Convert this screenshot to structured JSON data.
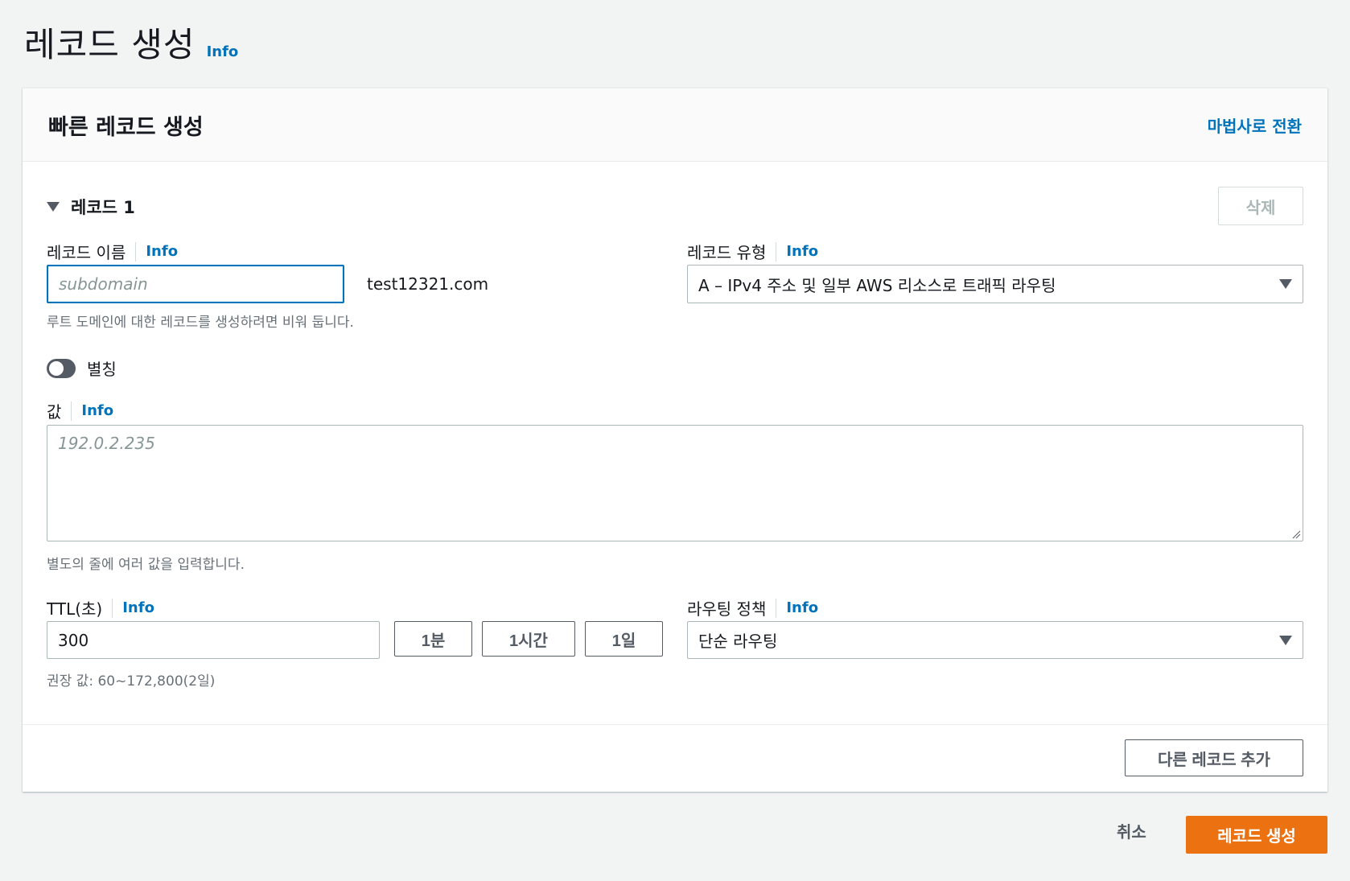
{
  "page": {
    "title": "레코드 생성",
    "info_label": "Info"
  },
  "panel": {
    "title": "빠른 레코드 생성",
    "wizard_link": "마법사로 전환"
  },
  "record": {
    "heading": "레코드 1",
    "delete_label": "삭제",
    "name": {
      "label": "레코드 이름",
      "info": "Info",
      "placeholder": "subdomain",
      "suffix": "test12321.com",
      "hint": "루트 도메인에 대한 레코드를 생성하려면 비워 둡니다."
    },
    "type": {
      "label": "레코드 유형",
      "info": "Info",
      "selected": "A – IPv4 주소 및 일부 AWS 리소스로 트래픽 라우팅"
    },
    "alias": {
      "label": "별칭",
      "enabled": false
    },
    "value": {
      "label": "값",
      "info": "Info",
      "placeholder": "192.0.2.235",
      "hint": "별도의 줄에 여러 값을 입력합니다."
    },
    "ttl": {
      "label": "TTL(초)",
      "info": "Info",
      "value": "300",
      "presets": [
        "1분",
        "1시간",
        "1일"
      ],
      "hint": "권장 값: 60~172,800(2일)"
    },
    "routing": {
      "label": "라우팅 정책",
      "info": "Info",
      "selected": "단순 라우팅"
    }
  },
  "footer": {
    "add_record": "다른 레코드 추가",
    "cancel": "취소",
    "create": "레코드 생성"
  },
  "colors": {
    "primary": "#ec7211",
    "link": "#0073bb",
    "focus_border": "#0073bb",
    "background": "#f2f3f3"
  }
}
